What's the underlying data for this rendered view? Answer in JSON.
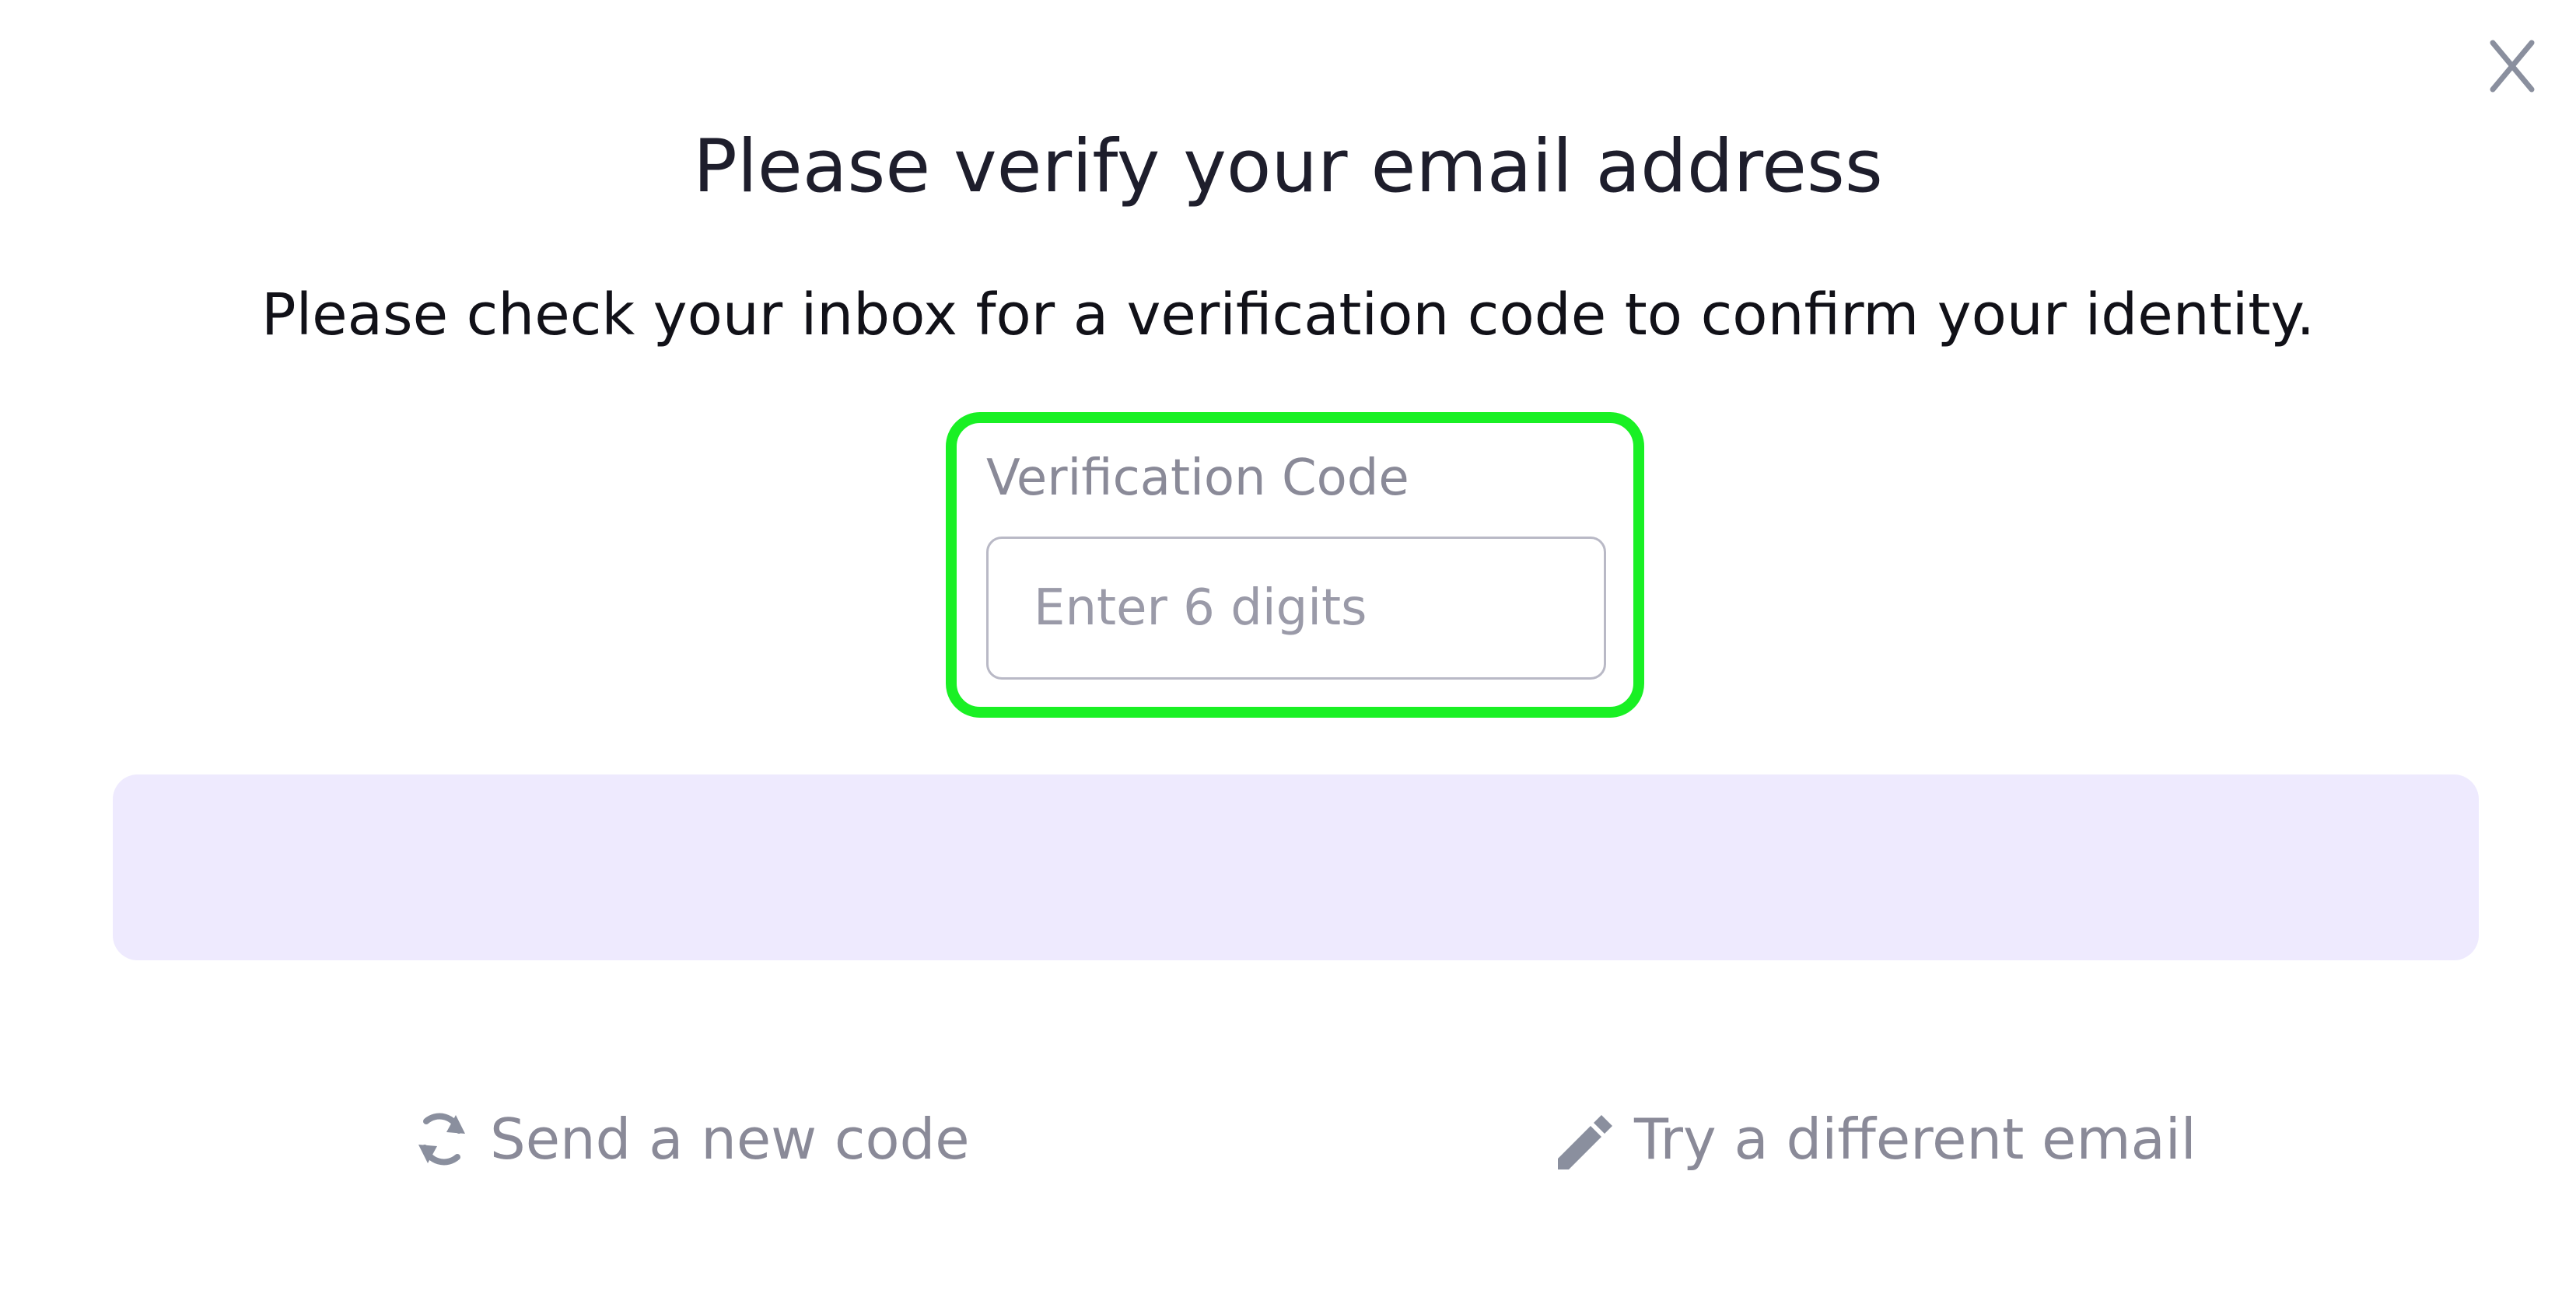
{
  "dialog": {
    "title": "Please verify your email address",
    "subtitle": "Please check your inbox for a verification code to confirm your identity.",
    "close_icon": "close-icon"
  },
  "verification": {
    "label": "Verification Code",
    "value": "",
    "placeholder": "Enter 6 digits"
  },
  "actions": {
    "send_new_code": {
      "label": "Send a new code",
      "icon": "refresh-icon"
    },
    "different_email": {
      "label": "Try a different email",
      "icon": "pencil-icon"
    }
  },
  "colors": {
    "highlight": "#19f024",
    "banner": "#eeeafe",
    "muted_text": "#8a8a98",
    "title_text": "#1e1e2c"
  }
}
